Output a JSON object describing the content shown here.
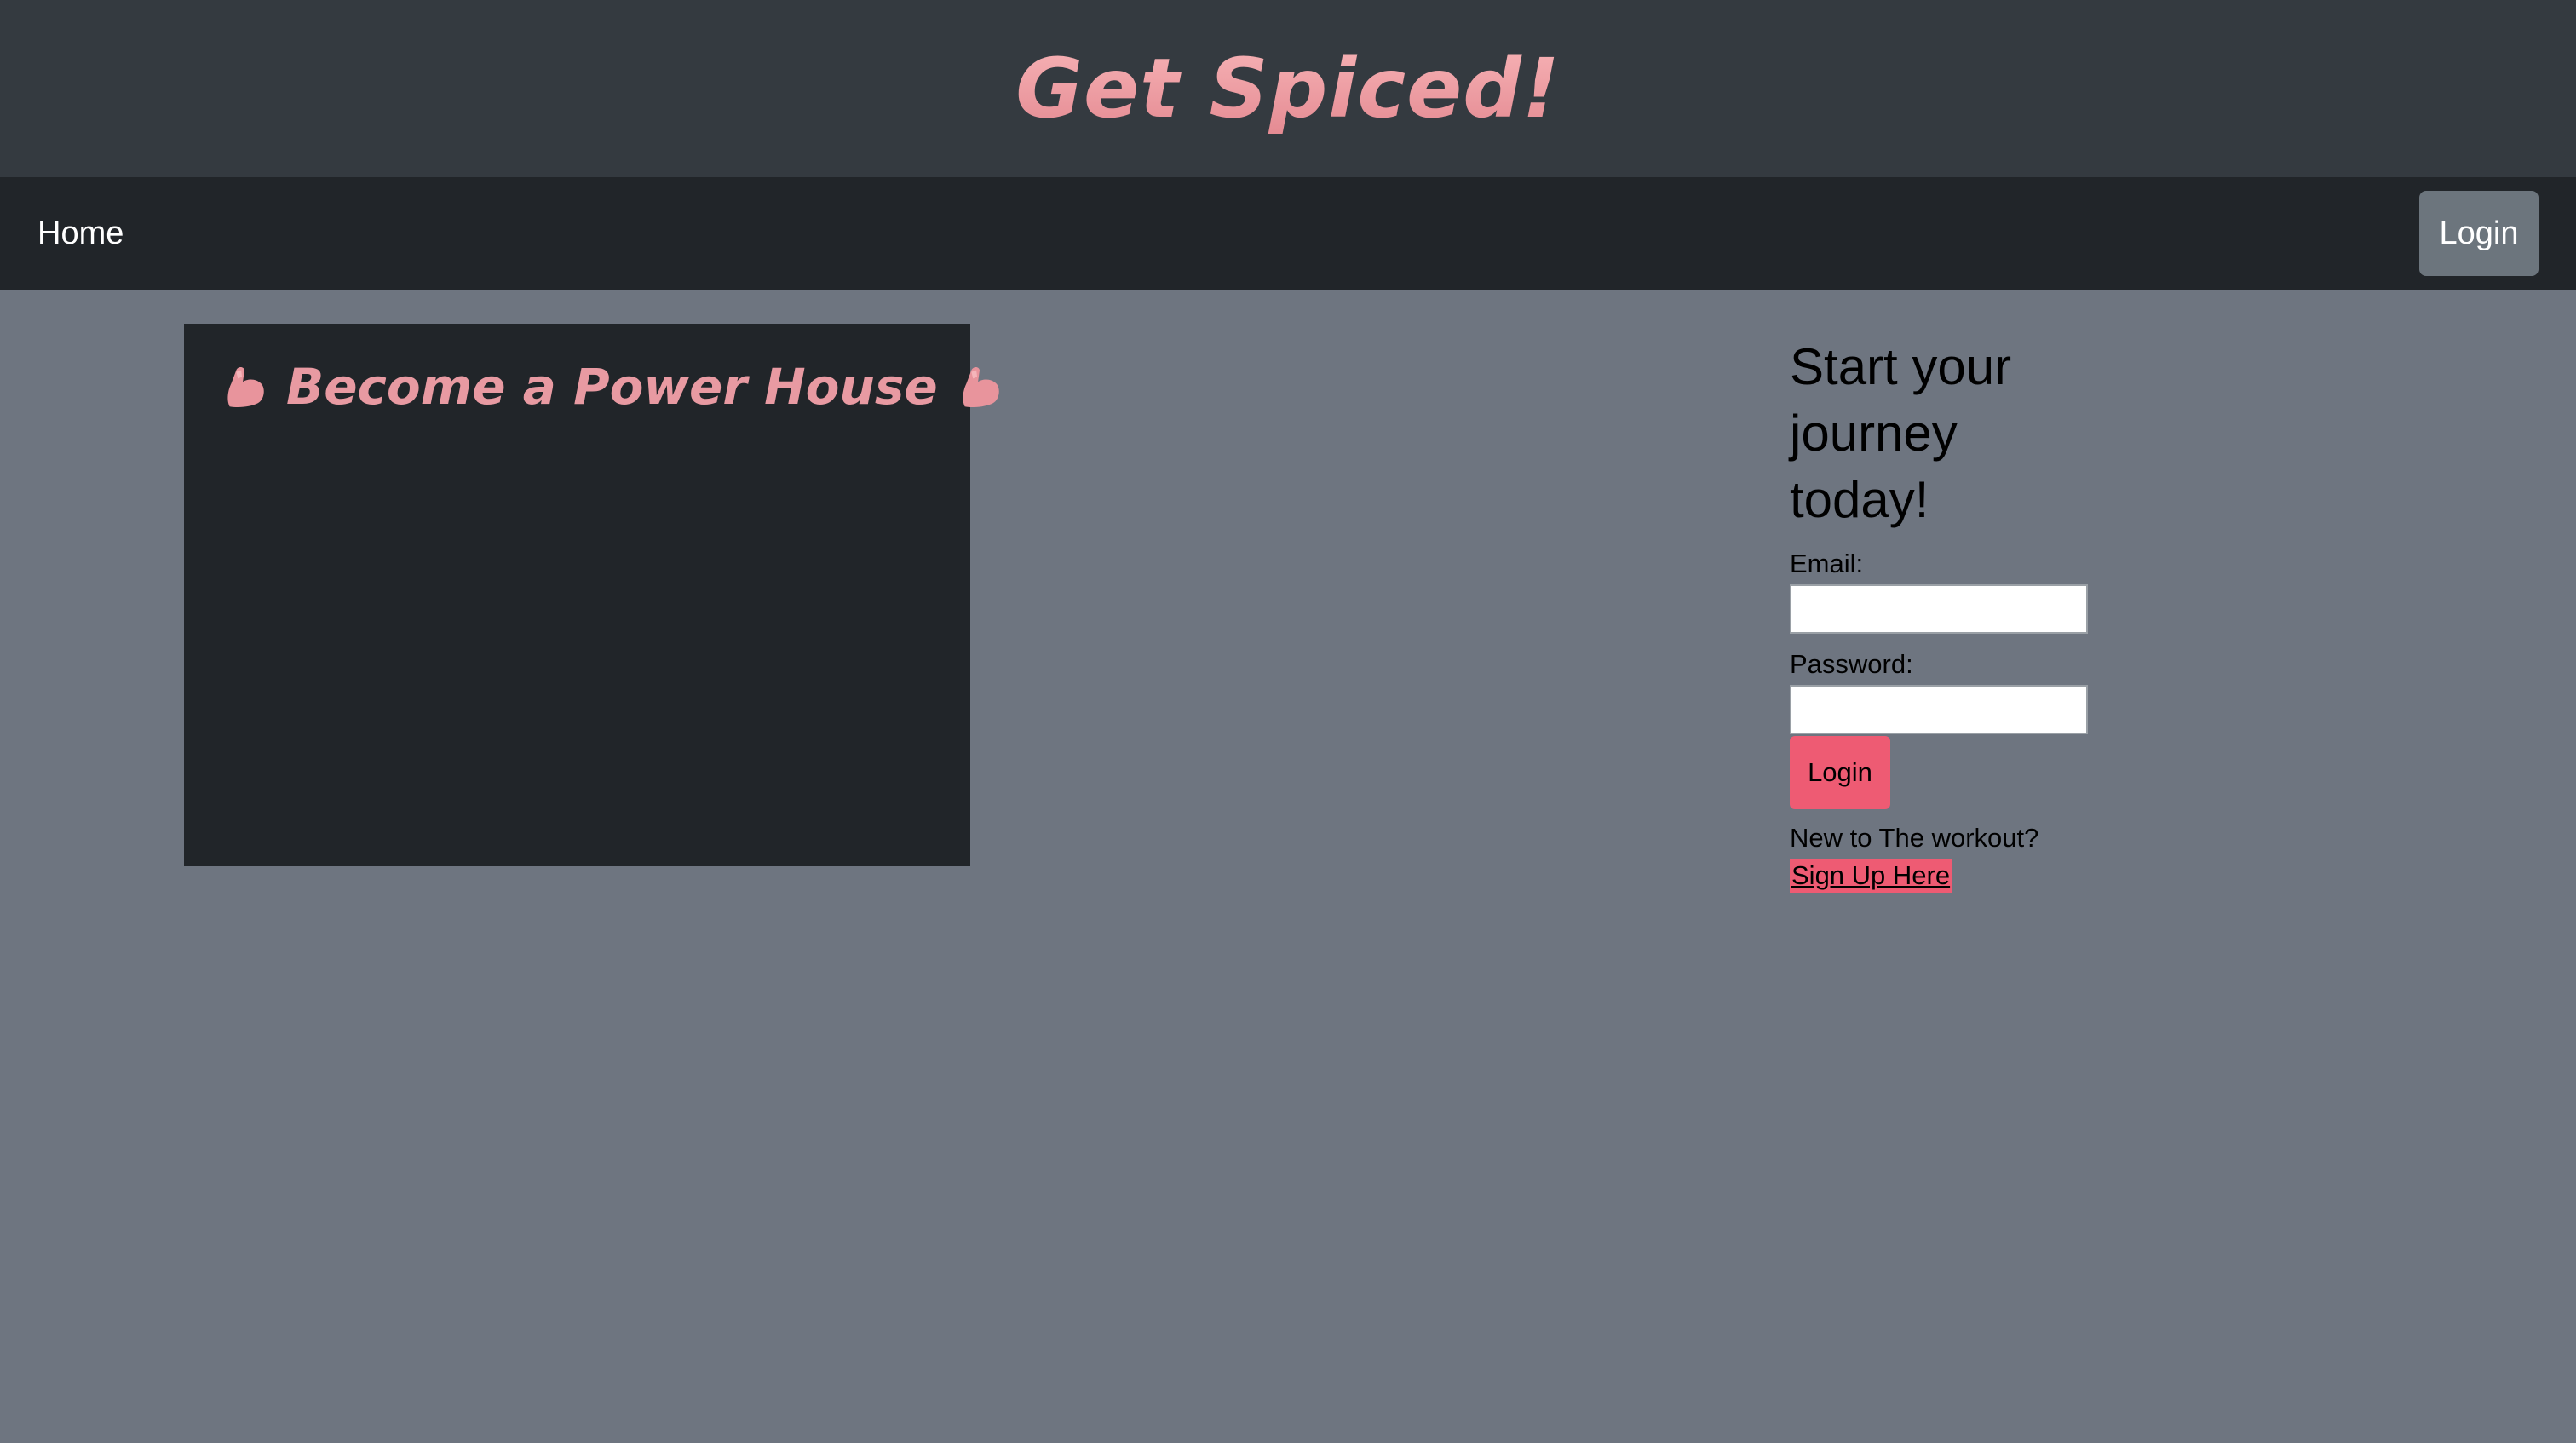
{
  "header": {
    "brand": "Get Spiced!"
  },
  "nav": {
    "home_label": "Home",
    "login_label": "Login"
  },
  "hero": {
    "title": "Become a Power House",
    "left_icon": "flexed-biceps-icon",
    "right_icon": "flexed-biceps-icon"
  },
  "form": {
    "heading": "Start your journey today!",
    "email_label": "Email:",
    "email_value": "",
    "password_label": "Password:",
    "password_value": "",
    "submit_label": "Login",
    "signup_prompt": "New to The workout?",
    "signup_link": "Sign Up Here"
  },
  "colors": {
    "header_bg": "#343a40",
    "navbar_bg": "#212529",
    "page_bg": "#6e7580",
    "brand_pink": "#e89aa2",
    "accent": "#ee5b73"
  }
}
